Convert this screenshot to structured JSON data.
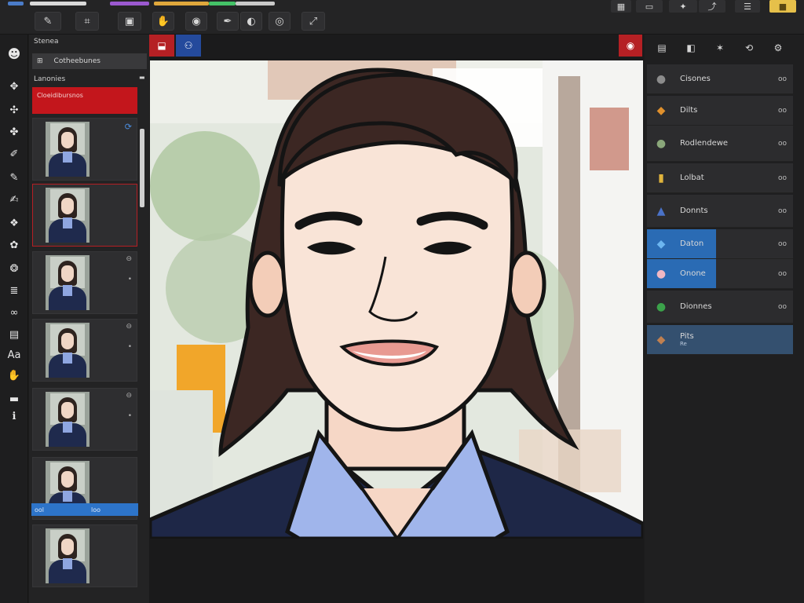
{
  "toolbar": {
    "color_strip": [
      "#4b7cc9",
      "#d9d9d9",
      "#9b59d0",
      "#e0a83c",
      "#44c267",
      "#c9c9c9"
    ],
    "buttons": [
      {
        "icon": "brush-icon",
        "glyph": "✎"
      },
      {
        "icon": "crop-icon",
        "glyph": "⌗"
      },
      {
        "icon": "image-icon",
        "glyph": "▣"
      },
      {
        "icon": "hand-icon",
        "glyph": "✋"
      },
      {
        "icon": "camera-icon",
        "glyph": "◉"
      },
      {
        "icon": "pen-icon",
        "glyph": "✒"
      },
      {
        "icon": "mask-icon",
        "glyph": "◐"
      },
      {
        "icon": "eye-icon",
        "glyph": "◎"
      },
      {
        "icon": "resize-icon",
        "glyph": "⤢"
      }
    ],
    "right_buttons": [
      {
        "icon": "grid-icon",
        "glyph": "▦"
      },
      {
        "icon": "window-icon",
        "glyph": "▭"
      },
      {
        "icon": "puzzle-icon",
        "glyph": "✦"
      },
      {
        "icon": "share-icon",
        "glyph": "⤴"
      },
      {
        "icon": "menu-icon",
        "glyph": "☰"
      },
      {
        "icon": "folder-icon",
        "glyph": "■"
      }
    ]
  },
  "tools": [
    {
      "icon": "avatar-tool-icon",
      "glyph": "☻"
    },
    {
      "icon": "move-tool-icon",
      "glyph": "✥"
    },
    {
      "icon": "branch-tool-icon",
      "glyph": "✣"
    },
    {
      "icon": "transform-tool-icon",
      "glyph": "✤"
    },
    {
      "icon": "brush-tool-icon",
      "glyph": "✐"
    },
    {
      "icon": "eraser-tool-icon",
      "glyph": "✎"
    },
    {
      "icon": "smudge-tool-icon",
      "glyph": "✍"
    },
    {
      "icon": "clone-tool-icon",
      "glyph": "❖"
    },
    {
      "icon": "blur-tool-icon",
      "glyph": "✿"
    },
    {
      "icon": "heal-tool-icon",
      "glyph": "❂"
    },
    {
      "icon": "stack-tool-icon",
      "glyph": "≣"
    },
    {
      "icon": "link-tool-icon",
      "glyph": "∞"
    },
    {
      "icon": "shape-tool-icon",
      "glyph": "▤"
    },
    {
      "icon": "text-tool-icon",
      "glyph": "Aa"
    },
    {
      "icon": "hand-tool-icon",
      "glyph": "✋"
    },
    {
      "icon": "slider-tool-icon",
      "glyph": "▬"
    },
    {
      "icon": "info-tool-icon",
      "glyph": "ℹ"
    }
  ],
  "layers": {
    "title": "Stenea",
    "filter_label": "Cotheebunes",
    "section_label": "Lanonies",
    "highlight_label": "Cloeidibursnos",
    "cards": [
      {
        "badge": "⟳",
        "active": false
      },
      {
        "badge": "",
        "active": true
      },
      {
        "badge": "⊖",
        "active": false
      },
      {
        "badge": "⊖",
        "active": false
      },
      {
        "badge": "⊖",
        "active": false
      },
      {
        "badge": "",
        "active": false,
        "selected_label_left": "ool",
        "selected_label_right": "loo"
      },
      {
        "badge": "",
        "active": false
      }
    ]
  },
  "canvas_bar": {
    "left_buttons": [
      {
        "icon": "suitcase-icon",
        "glyph": "⬓",
        "color": "#b52024"
      },
      {
        "icon": "people-icon",
        "glyph": "⚇",
        "color": "#244a9c"
      }
    ],
    "right_button": {
      "icon": "eye-red-icon",
      "glyph": "◉",
      "color": "#b52024"
    }
  },
  "right_panel": {
    "tabs": [
      {
        "icon": "layers-tab-icon",
        "glyph": "▤"
      },
      {
        "icon": "adjust-tab-icon",
        "glyph": "◧"
      },
      {
        "icon": "fx-tab-icon",
        "glyph": "✶"
      },
      {
        "icon": "history-tab-icon",
        "glyph": "⟲"
      },
      {
        "icon": "settings-tab-icon",
        "glyph": "⚙"
      }
    ],
    "items": [
      {
        "label": "Cisones",
        "glyph": "●",
        "color": "#8c8c8c",
        "eye": "oo",
        "highlight": false
      },
      {
        "label": "Dilts",
        "glyph": "◆",
        "color": "#e0902c",
        "eye": "oo",
        "highlight": false
      },
      {
        "label": "Rodlendewe",
        "glyph": "●",
        "color": "#8aa77a",
        "eye": "oo",
        "highlight": false
      },
      {
        "label": "Lolbat",
        "glyph": "▮",
        "color": "#e0b43c",
        "eye": "oo",
        "highlight": false
      },
      {
        "label": "Donnts",
        "glyph": "▲",
        "color": "#4a72c8",
        "eye": "oo",
        "highlight": false
      },
      {
        "label": "Daton",
        "glyph": "◆",
        "color": "#6cb6f0",
        "eye": "oo",
        "highlight": true
      },
      {
        "label": "Onone",
        "glyph": "●",
        "color": "#f0b8c4",
        "eye": "oo",
        "highlight": true
      },
      {
        "label": "Dionnes",
        "glyph": "●",
        "color": "#3ba24a",
        "eye": "oo",
        "highlight": false
      },
      {
        "label": "Pits",
        "sublabel": "Re",
        "glyph": "◆",
        "color": "#c08050",
        "eye": "",
        "highlight": true
      }
    ]
  }
}
